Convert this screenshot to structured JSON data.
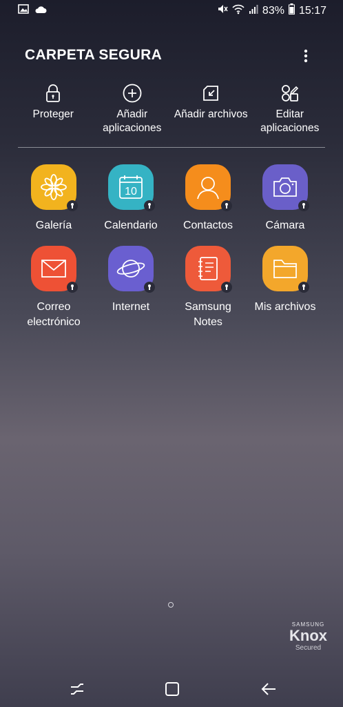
{
  "status": {
    "battery": "83%",
    "time": "15:17"
  },
  "header": {
    "title": "CARPETA SEGURA"
  },
  "actions": [
    {
      "label": "Proteger",
      "icon": "lock-icon"
    },
    {
      "label": "Añadir aplicaciones",
      "icon": "add-circle-icon"
    },
    {
      "label": "Añadir archivos",
      "icon": "add-files-icon"
    },
    {
      "label": "Editar aplicaciones",
      "icon": "edit-apps-icon"
    }
  ],
  "apps": [
    {
      "label": "Galería",
      "color": "#f2b31e"
    },
    {
      "label": "Calendario",
      "color": "#35b3c4",
      "date": "10"
    },
    {
      "label": "Contactos",
      "color": "#f58d1c"
    },
    {
      "label": "Cámara",
      "color": "#6a5fc9"
    },
    {
      "label": "Correo electrónico",
      "color": "#ee5135"
    },
    {
      "label": "Internet",
      "color": "#6a5fd0"
    },
    {
      "label": "Samsung Notes",
      "color": "#ee5a3a"
    },
    {
      "label": "Mis archivos",
      "color": "#f3a72b"
    }
  ],
  "knox": {
    "brand": "SAMSUNG",
    "name": "Knox",
    "tag": "Secured"
  }
}
